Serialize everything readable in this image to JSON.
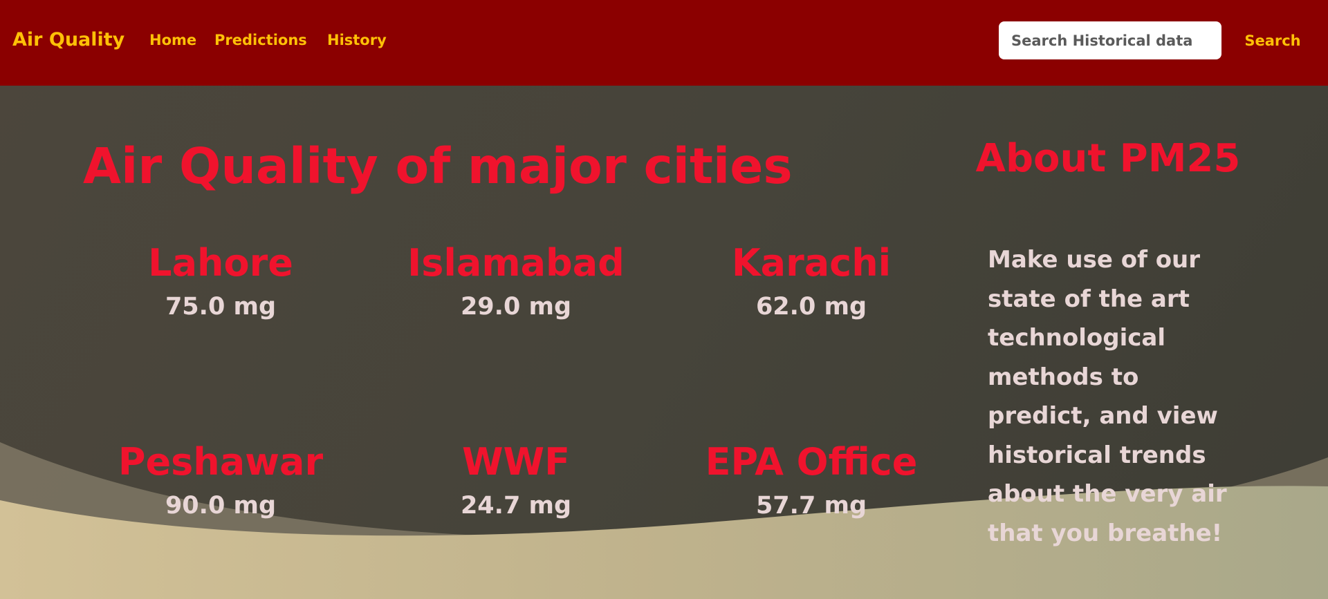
{
  "navbar": {
    "brand": "Air Quality",
    "links": [
      "Home",
      "Predictions",
      "History"
    ],
    "search_placeholder": "Search Historical data",
    "search_button": "Search"
  },
  "main": {
    "title": "Air Quality of major cities",
    "cities": [
      {
        "name": "Lahore",
        "value": "75.0 mg"
      },
      {
        "name": "Islamabad",
        "value": "29.0 mg"
      },
      {
        "name": "Karachi",
        "value": "62.0 mg"
      },
      {
        "name": "Peshawar",
        "value": "90.0 mg"
      },
      {
        "name": "WWF",
        "value": "24.7 mg"
      },
      {
        "name": "EPA Office",
        "value": "57.7 mg"
      }
    ]
  },
  "about": {
    "title": "About PM25",
    "text": "Make use of our state of the art technological methods to predict, and view historical trends about the very air that you breathe!"
  },
  "colors": {
    "navbar_bg": "#8b0000",
    "nav_text": "#ffc107",
    "heading_red": "#f0132d",
    "value_text": "#e8d6d6",
    "background_dark": "#46443a",
    "wave_sand": "#cdbf98"
  }
}
